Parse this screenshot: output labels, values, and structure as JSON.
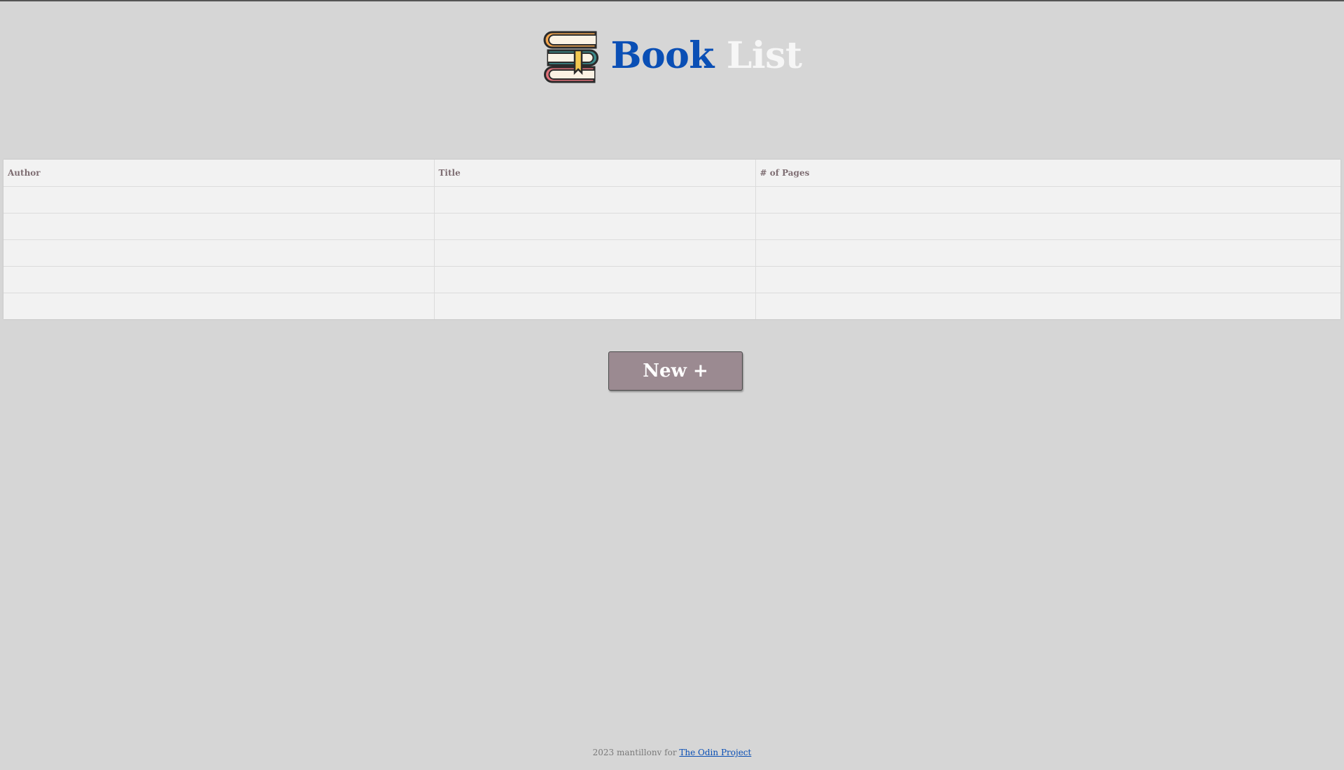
{
  "header": {
    "logo_icon": "book-stack-icon",
    "title_word1": "Book",
    "title_word2": "List",
    "colors": {
      "title_word1": "#0a4fb5",
      "title_word2": "#f6f6f6"
    }
  },
  "table": {
    "columns": [
      "Author",
      "Title",
      "# of Pages"
    ],
    "rows": [
      [
        "",
        "",
        ""
      ],
      [
        "",
        "",
        ""
      ],
      [
        "",
        "",
        ""
      ],
      [
        "",
        "",
        ""
      ],
      [
        "",
        "",
        ""
      ]
    ]
  },
  "actions": {
    "new_button_label": "New +",
    "new_button_color": "#9b8a91"
  },
  "footer": {
    "text": "2023 mantillonv for",
    "link_text": "The Odin Project"
  }
}
